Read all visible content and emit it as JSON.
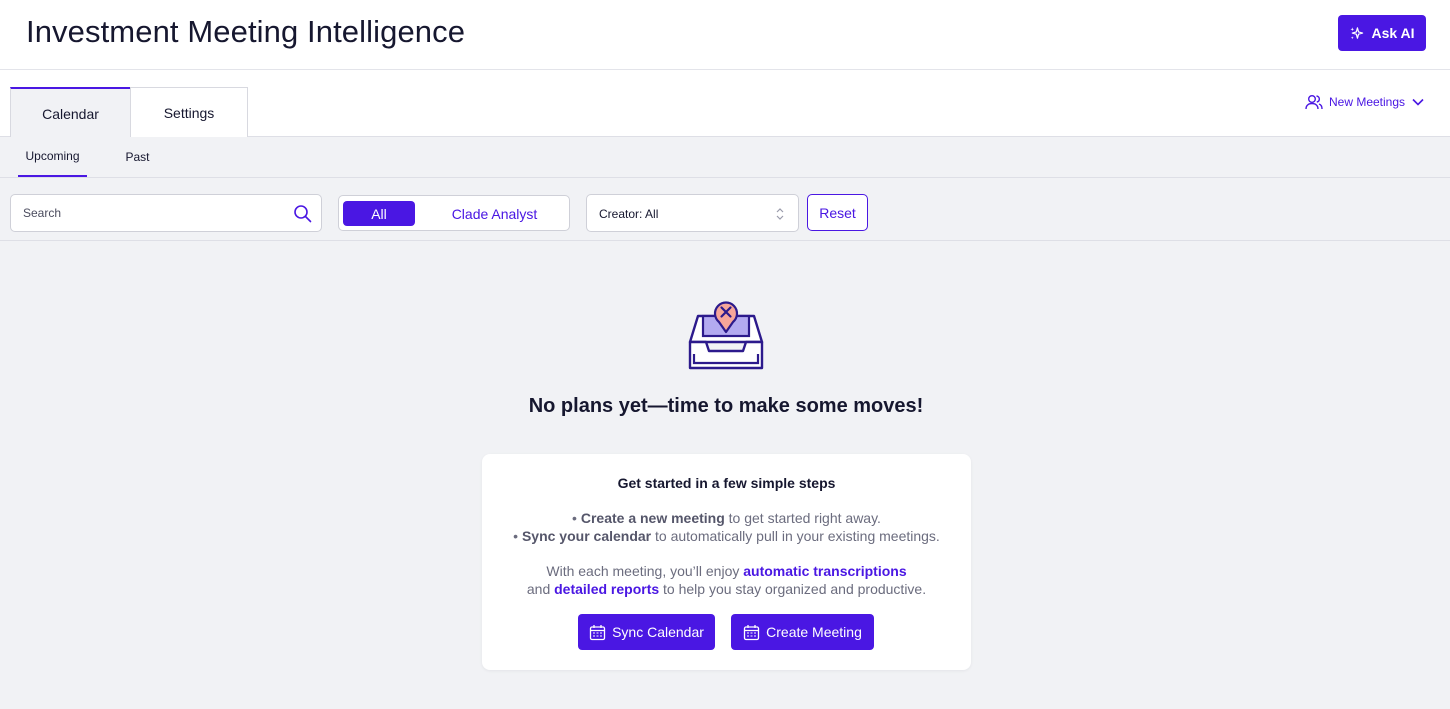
{
  "header": {
    "title": "Investment Meeting Intelligence",
    "ask_ai_label": "Ask AI"
  },
  "tabs": [
    {
      "label": "Calendar",
      "active": true
    },
    {
      "label": "Settings",
      "active": false
    }
  ],
  "new_meetings_label": "New Meetings",
  "subtabs": [
    {
      "label": "Upcoming",
      "active": true
    },
    {
      "label": "Past",
      "active": false
    }
  ],
  "filters": {
    "search_placeholder": "Search",
    "segments": [
      {
        "label": "All",
        "selected": true
      },
      {
        "label": "Clade Analyst",
        "selected": false
      }
    ],
    "creator_label": "Creator: All",
    "reset_label": "Reset"
  },
  "empty_state": {
    "heading": "No plans yet—time to make some moves!",
    "card": {
      "title": "Get started in a few simple steps",
      "step1_strong": "Create a new meeting",
      "step1_rest": " to get started right away.",
      "step2_strong": "Sync your calendar",
      "step2_rest": " to automatically pull in your existing meetings.",
      "benefit_prefix": "With each meeting, you’ll enjoy ",
      "benefit_link1": "automatic transcriptions",
      "benefit_mid": "and ",
      "benefit_link2": "detailed reports",
      "benefit_suffix": " to help you stay organized and productive.",
      "sync_label": "Sync Calendar",
      "create_label": "Create Meeting"
    }
  },
  "colors": {
    "accent": "#4a17e3",
    "background": "#f1f2f5",
    "illustration_pin": "#f6a69a",
    "illustration_tray": "#b3aaf0"
  }
}
